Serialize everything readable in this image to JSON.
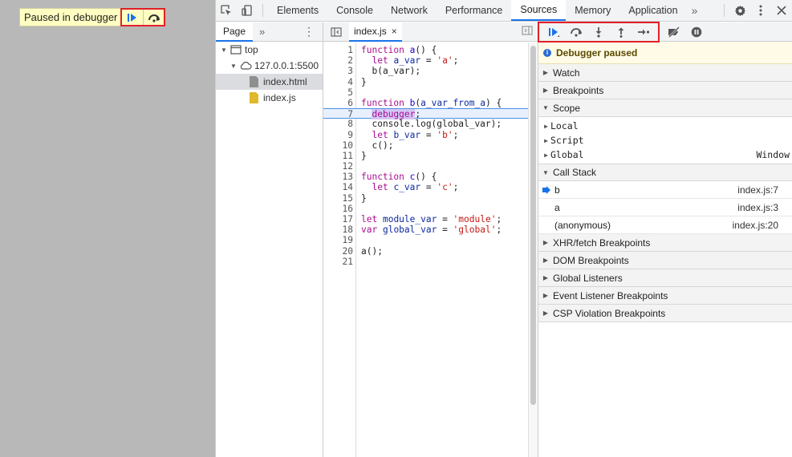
{
  "page": {
    "overlay": {
      "label": "Paused in debugger",
      "resume_icon": "resume-icon",
      "step_over_icon": "step-over-icon"
    }
  },
  "toolbar": {
    "tabs": [
      "Elements",
      "Console",
      "Network",
      "Performance",
      "Sources",
      "Memory",
      "Application"
    ],
    "active_tab": "Sources",
    "more": "»",
    "accent": "#1a73e8"
  },
  "navigator": {
    "tab": "Page",
    "more": "»",
    "tree": {
      "top": "top",
      "origin": "127.0.0.1:5500",
      "files": [
        "index.html",
        "index.js"
      ],
      "selected": "index.html"
    }
  },
  "editor": {
    "file_tab": "index.js",
    "close": "×",
    "paused_line": 7,
    "line_numbers": [
      "1",
      "2",
      "3",
      "4",
      "5",
      "6",
      "7",
      "8",
      "9",
      "10",
      "11",
      "12",
      "13",
      "14",
      "15",
      "16",
      "17",
      "18",
      "19",
      "20",
      "21"
    ]
  },
  "debugger": {
    "banner": "Debugger paused",
    "sections": {
      "watch": "Watch",
      "breakpoints": "Breakpoints",
      "scope": "Scope",
      "call_stack": "Call Stack",
      "xhr": "XHR/fetch Breakpoints",
      "dom": "DOM Breakpoints",
      "global_listeners": "Global Listeners",
      "event_listener": "Event Listener Breakpoints",
      "csp": "CSP Violation Breakpoints"
    },
    "scope": {
      "local": "Local",
      "script": "Script",
      "global": "Global",
      "global_value": "Window"
    },
    "call_stack": [
      {
        "fn": "b",
        "loc": "index.js:7"
      },
      {
        "fn": "a",
        "loc": "index.js:3"
      },
      {
        "fn": "(anonymous)",
        "loc": "index.js:20"
      }
    ]
  }
}
